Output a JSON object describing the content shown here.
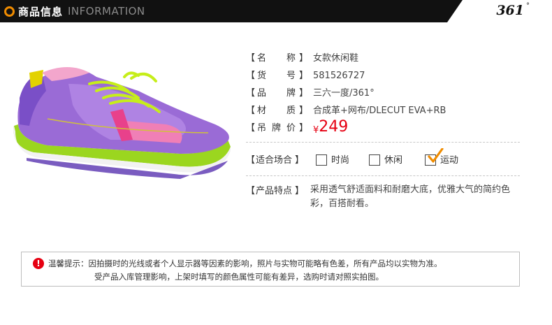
{
  "header": {
    "title_cn": "商品信息",
    "title_en": "INFORMATION",
    "brand_logo": "361",
    "brand_logo_degree": "°",
    "accent_color": "#f08c00"
  },
  "product": {
    "rows": [
      {
        "label_chars": [
          "名",
          "称"
        ],
        "value": "女款休闲鞋"
      },
      {
        "label_chars": [
          "货",
          "号"
        ],
        "value": "581526727"
      },
      {
        "label_chars": [
          "品",
          "牌"
        ],
        "value": "三六一度/361°"
      },
      {
        "label_chars": [
          "材",
          "质"
        ],
        "value": "合成革+网布/DLECUT EVA+RB"
      }
    ],
    "price_label_chars": [
      "吊",
      "牌",
      "价"
    ],
    "price_currency": "¥",
    "price_value": "249",
    "price_color": "#e60012"
  },
  "occasion": {
    "label": "适合场合",
    "options": [
      {
        "label": "时尚",
        "checked": false
      },
      {
        "label": "休闲",
        "checked": false
      },
      {
        "label": "运动",
        "checked": true
      }
    ]
  },
  "features": {
    "label": "产品特点",
    "text": "采用透气舒适面料和耐磨大底，优雅大气的简约色彩，百搭耐看。"
  },
  "notice": {
    "icon": "alert-icon",
    "line1": "温馨提示：因拍摄时的光线或者个人显示器等因素的影响，照片与实物可能略有色差，所有产品均以实物为准。",
    "line2": "受产品入库管理影响，上架时填写的颜色属性可能有差异，选购时请对照实拍图。"
  },
  "brackets": {
    "open": "【",
    "close": "】"
  }
}
